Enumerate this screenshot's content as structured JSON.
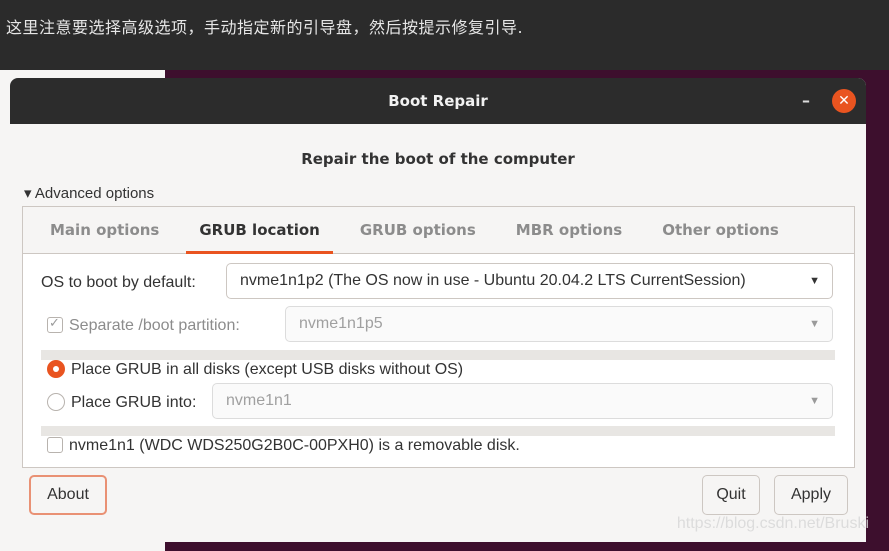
{
  "caption": "这里注意要选择高级选项，手动指定新的引导盘，然后按提示修复引导.",
  "window": {
    "title": "Boot Repair",
    "minimize": "–",
    "close": "✕"
  },
  "headline": "Repair the boot of the computer",
  "advanced_label": "Advanced options",
  "tabs": [
    "Main options",
    "GRUB location",
    "GRUB options",
    "MBR options",
    "Other options"
  ],
  "grub_location": {
    "os_label": "OS to boot by default:",
    "os_value": "nvme1n1p2 (The OS now in use - Ubuntu 20.04.2 LTS CurrentSession)",
    "separate_boot_label": "Separate /boot partition:",
    "separate_boot_value": "nvme1n1p5",
    "place_all_label": "Place GRUB in all disks (except USB disks without OS)",
    "place_into_label": "Place GRUB into:",
    "place_into_value": "nvme1n1",
    "removable_label": "nvme1n1 (WDC WDS250G2B0C-00PXH0) is a removable disk."
  },
  "buttons": {
    "about": "About",
    "quit": "Quit",
    "apply": "Apply"
  },
  "watermark": "https://blog.csdn.net/Bruski",
  "colors": {
    "accent": "#e95420",
    "titlebar": "#2c2c2c"
  }
}
